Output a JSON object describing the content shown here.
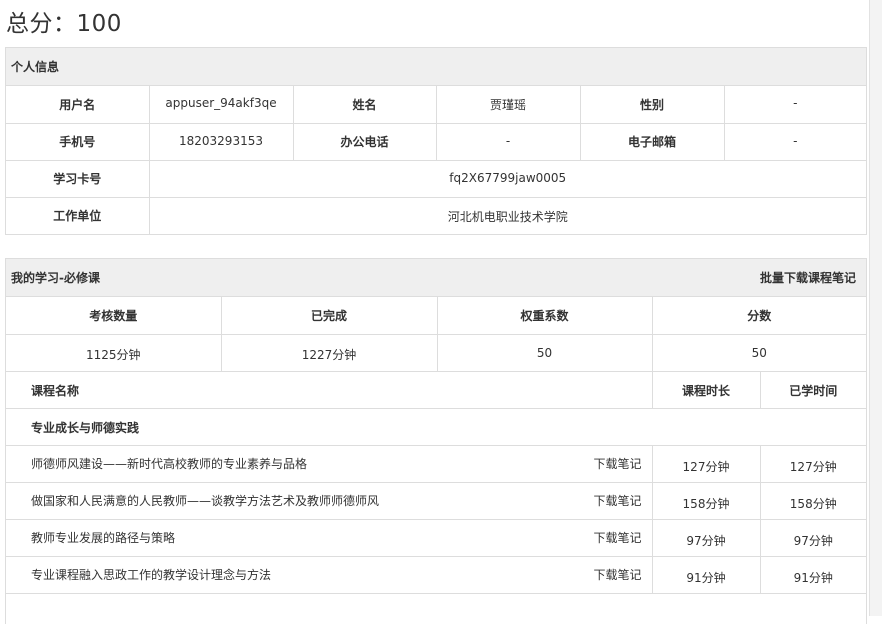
{
  "total_score": "总分：100",
  "personal": {
    "title": "个人信息",
    "rows": [
      [
        "用户名",
        "appuser_94akf3qe",
        "姓名",
        "贾瑾瑶",
        "性别",
        "-"
      ],
      [
        "手机号",
        "18203293153",
        "办公电话",
        "-",
        "电子邮箱",
        "-"
      ]
    ],
    "card_label": "学习卡号",
    "card_value": "fq2X67799jaw0005",
    "unit_label": "工作单位",
    "unit_value": "河北机电职业技术学院"
  },
  "study": {
    "title": "我的学习-必修课",
    "batch_download": "批量下载课程笔记",
    "summary_headers": [
      "考核数量",
      "已完成",
      "权重系数",
      "分数"
    ],
    "summary_values": [
      "1125分钟",
      "1227分钟",
      "50",
      "50"
    ],
    "course_headers": [
      "课程名称",
      "课程时长",
      "已学时间"
    ],
    "category": "专业成长与师德实践",
    "download_label": "下载笔记",
    "courses": [
      {
        "name": "师德师风建设——新时代高校教师的专业素养与品格",
        "duration": "127分钟",
        "learned": "127分钟"
      },
      {
        "name": "做国家和人民满意的人民教师——谈教学方法艺术及教师师德师风",
        "duration": "158分钟",
        "learned": "158分钟"
      },
      {
        "name": "教师专业发展的路径与策略",
        "duration": "97分钟",
        "learned": "97分钟"
      },
      {
        "name": "专业课程融入思政工作的教学设计理念与方法",
        "duration": "91分钟",
        "learned": "91分钟"
      }
    ]
  }
}
